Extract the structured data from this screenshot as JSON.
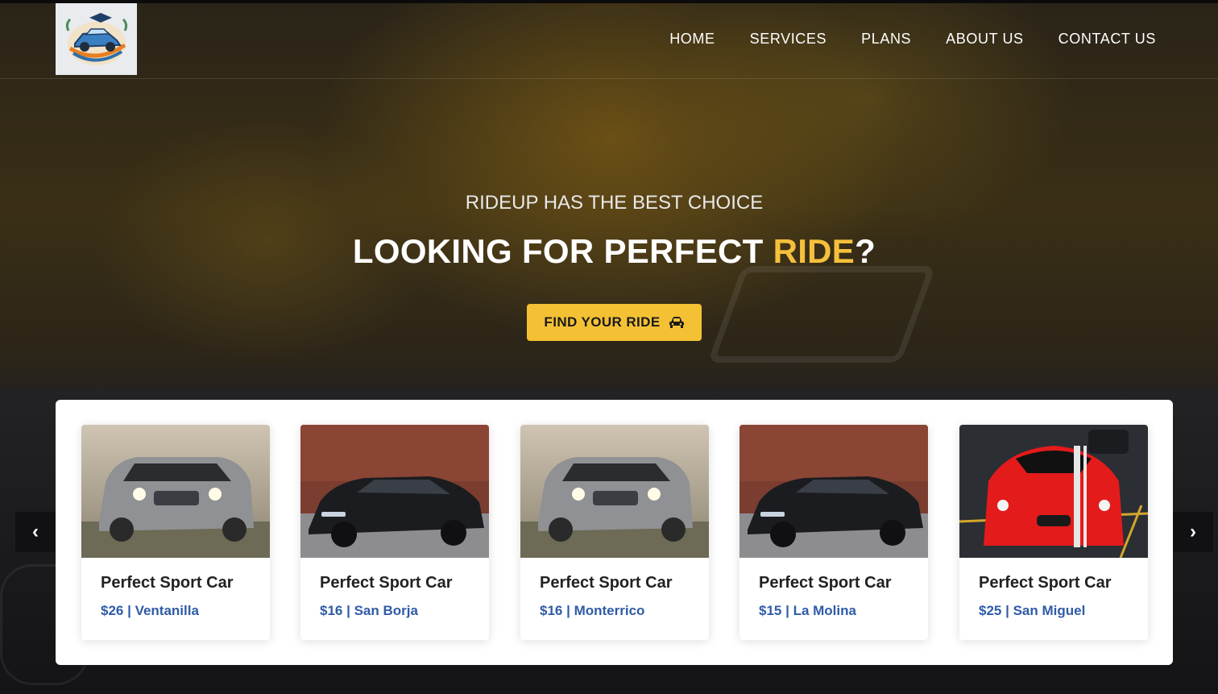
{
  "nav": {
    "logo_alt": "RideUp logo",
    "links": [
      "HOME",
      "SERVICES",
      "PLANS",
      "ABOUT US",
      "CONTACT US"
    ]
  },
  "hero": {
    "subtitle": "RIDEUP HAS THE BEST CHOICE",
    "title_prefix": "LOOKING FOR PERFECT ",
    "title_accent": "RIDE",
    "title_suffix": "?",
    "cta_label": "FIND YOUR RIDE",
    "cta_icon": "car-icon",
    "accent_color": "#f5c03c"
  },
  "carousel": {
    "prev_label": "‹",
    "next_label": "›",
    "cards": [
      {
        "title": "Perfect Sport Car",
        "price": "$26",
        "location": "Ventanilla",
        "meta": "$26 | Ventanilla",
        "image": "silver-suv"
      },
      {
        "title": "Perfect Sport Car",
        "price": "$16",
        "location": "San Borja",
        "meta": "$16 | San Borja",
        "image": "black-sedan"
      },
      {
        "title": "Perfect Sport Car",
        "price": "$16",
        "location": "Monterrico",
        "meta": "$16 | Monterrico",
        "image": "silver-suv"
      },
      {
        "title": "Perfect Sport Car",
        "price": "$15",
        "location": "La Molina",
        "meta": "$15 | La Molina",
        "image": "black-sedan"
      },
      {
        "title": "Perfect Sport Car",
        "price": "$25",
        "location": "San Miguel",
        "meta": "$25 | San Miguel",
        "image": "red-sports-car"
      }
    ]
  }
}
